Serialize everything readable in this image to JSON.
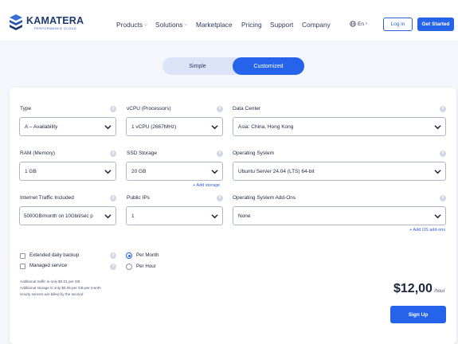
{
  "brand": {
    "name": "KAMATERA",
    "tagline": "PERFORMANCE CLOUD"
  },
  "nav": {
    "items": [
      {
        "label": "Products",
        "dropdown": true
      },
      {
        "label": "Solutions",
        "dropdown": true
      },
      {
        "label": "Marketplace",
        "dropdown": false
      },
      {
        "label": "Pricing",
        "dropdown": false
      },
      {
        "label": "Support",
        "dropdown": false
      },
      {
        "label": "Company",
        "dropdown": false
      }
    ]
  },
  "header": {
    "language": "En",
    "login_label": "Log in",
    "cta_label": "Get Started"
  },
  "mode_toggle": {
    "simple_label": "Simple",
    "customized_label": "Customized",
    "active": "Customized"
  },
  "config": {
    "type": {
      "label": "Type",
      "value": "A – Availability"
    },
    "vcpu": {
      "label": "vCPU (Processors)",
      "value": "1 vCPU (2667MHz)"
    },
    "datacenter": {
      "label": "Data Center",
      "value": "Asia: China, Hong Kong"
    },
    "ram": {
      "label": "RAM (Memory)",
      "value": "1 GB"
    },
    "ssd": {
      "label": "SSD Storage",
      "value": "20 GB",
      "add_link": "+ Add storage"
    },
    "os": {
      "label": "Operating System",
      "value": "Ubuntu Server 24.04 (LTS) 64-bit"
    },
    "traffic": {
      "label": "Internet Traffic Included",
      "value": "5000GB/month on 10Gbit/sec p"
    },
    "public_ips": {
      "label": "Public IPs",
      "value": "1"
    },
    "os_addons": {
      "label": "Operating System Add-Ons",
      "value": "None",
      "add_link": "+ Add OS add-ons"
    }
  },
  "options": {
    "backup_label": "Extended daily backup",
    "managed_label": "Managed service",
    "per_month_label": "Per Month",
    "per_hour_label": "Per Hour",
    "billing_selected": "Per Month"
  },
  "notes": [
    "Additional traffic is only $0.01 per GB",
    "Additional storage is only $0.05 per GB per month",
    "Hourly servers are billed by the second"
  ],
  "pricing": {
    "amount": "$12,00",
    "unit": "/hour",
    "signup_label": "Sign Up"
  },
  "colors": {
    "accent": "#2563eb",
    "brand": "#1e3a6f",
    "background": "#f4f6fb"
  }
}
